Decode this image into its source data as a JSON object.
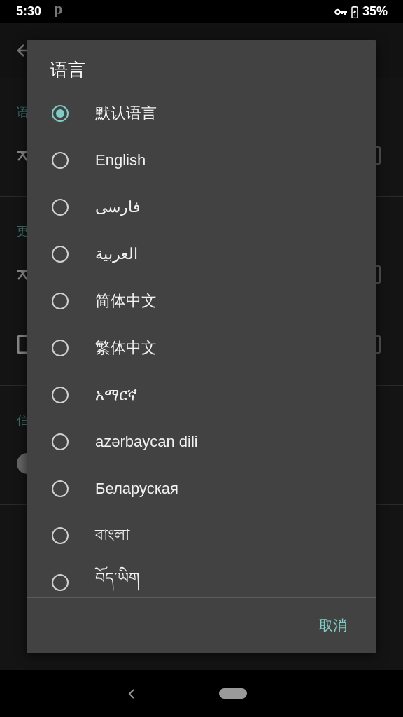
{
  "status_bar": {
    "time": "5:30",
    "notification": "p",
    "battery": "35%"
  },
  "background": {
    "sections": [
      {
        "header": "语",
        "rows": [
          {
            "kind": "icon"
          }
        ]
      },
      {
        "header": "更",
        "rows": [
          {
            "kind": "icon"
          },
          {
            "kind": "checkbox"
          }
        ]
      },
      {
        "header": "信",
        "rows": [
          {
            "kind": "toggle"
          }
        ]
      }
    ]
  },
  "dialog": {
    "title": "语言",
    "options": [
      {
        "label": "默认语言",
        "selected": true
      },
      {
        "label": "English",
        "selected": false
      },
      {
        "label": "فارسی",
        "selected": false
      },
      {
        "label": "العربية",
        "selected": false
      },
      {
        "label": "简体中文",
        "selected": false
      },
      {
        "label": "繁体中文",
        "selected": false
      },
      {
        "label": "አማርኛ",
        "selected": false
      },
      {
        "label": "azərbaycan dili",
        "selected": false
      },
      {
        "label": "Беларуская",
        "selected": false
      },
      {
        "label": "বাংলা",
        "selected": false
      },
      {
        "label": "བོད་ཡིག",
        "selected": false
      }
    ],
    "buttons": [
      "取消"
    ]
  }
}
